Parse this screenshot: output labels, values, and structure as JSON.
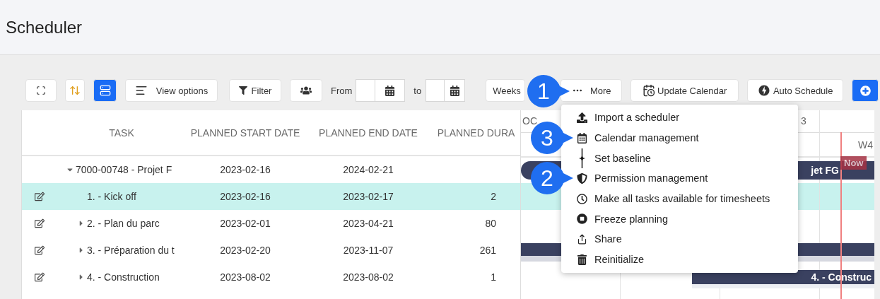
{
  "header": {
    "title": "Scheduler"
  },
  "toolbar": {
    "active_view_selected": true,
    "view_options": "View options",
    "filter": "Filter",
    "from_label": "From",
    "to_label": "to",
    "scale": "Weeks",
    "more": "More",
    "update_calendar": "Update Calendar",
    "auto_schedule": "Auto Schedule"
  },
  "table": {
    "columns": [
      "TASK",
      "PLANNED START DATE",
      "PLANNED END DATE",
      "PLANNED DURA"
    ],
    "rows": [
      {
        "task": "7000-00748 - Projet F",
        "start": "2023-02-16",
        "end": "2024-02-21",
        "editable": false,
        "selected": false,
        "expanded": true,
        "children": [
          {
            "task": "1. - Kick off",
            "start": "2023-02-16",
            "end": "2023-02-17",
            "duration": "2",
            "editable": true,
            "selected": true
          },
          {
            "task": "2. - Plan du parc",
            "start": "2023-02-01",
            "end": "2023-04-21",
            "duration": "80",
            "editable": true,
            "selected": false,
            "expanded": false
          },
          {
            "task": "3. - Préparation du t",
            "start": "2023-02-20",
            "end": "2023-11-07",
            "duration": "261",
            "editable": true,
            "selected": false,
            "expanded": false
          },
          {
            "task": "4. - Construction",
            "start": "2023-08-02",
            "end": "2023-08-02",
            "duration": "1",
            "editable": true,
            "selected": false,
            "expanded": false
          }
        ]
      }
    ]
  },
  "gantt": {
    "months": [
      "OC",
      "3"
    ],
    "weeks": [
      "W4"
    ],
    "now_label": "Now",
    "bars": [
      {
        "kind": "summary",
        "label": "jet FG"
      },
      {
        "kind": "summary"
      },
      {
        "kind": "task",
        "label": "4. - Construc"
      }
    ]
  },
  "more_menu": {
    "items": [
      {
        "kind": "upload",
        "label": "Import a scheduler"
      },
      {
        "kind": "calendar",
        "label": "Calendar management"
      },
      {
        "kind": "baseline",
        "label": "Set baseline"
      },
      {
        "kind": "shield",
        "label": "Permission management"
      },
      {
        "kind": "clock",
        "label": "Make all tasks available for timesheets"
      },
      {
        "kind": "stop",
        "label": "Freeze planning"
      },
      {
        "kind": "share",
        "label": "Share"
      },
      {
        "kind": "trash",
        "label": "Reinitialize"
      }
    ]
  },
  "callouts": [
    {
      "label": "1"
    },
    {
      "label": "3"
    },
    {
      "label": "2"
    }
  ]
}
